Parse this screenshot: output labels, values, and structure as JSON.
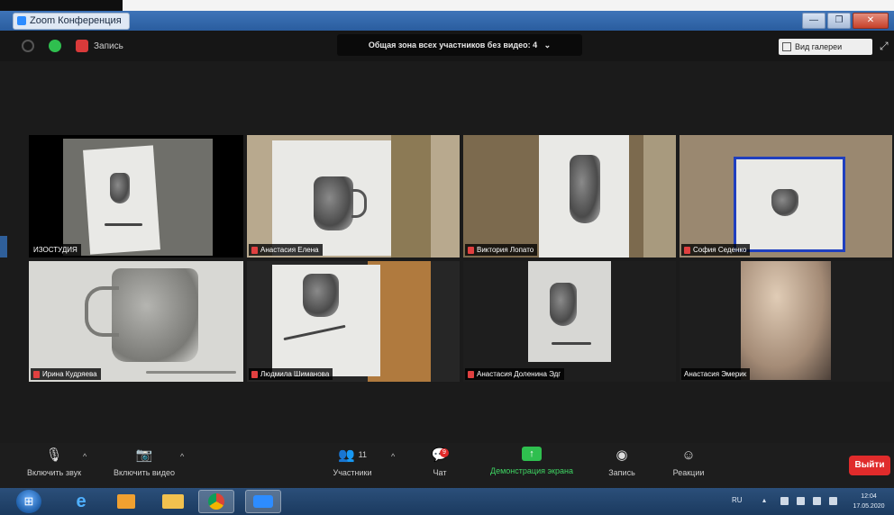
{
  "window": {
    "title": "Zoom Конференция",
    "buttons": [
      "—",
      "❐",
      "✕"
    ]
  },
  "top_bar": {
    "record_label": "Запись",
    "banner": "Общая зона всех участников без видео: 4",
    "view_button": "Вид галереи"
  },
  "gallery": [
    {
      "name": "ИЗОСТУДИЯ"
    },
    {
      "name": "Анастасия Елена"
    },
    {
      "name": "Виктория Лопато"
    },
    {
      "name": "София Седенко"
    },
    {
      "name": "Ирина Кудряева"
    },
    {
      "name": "Людмила Шиманова"
    },
    {
      "name": "Анастасия Доленина Эдг"
    },
    {
      "name": "Анастасия Эмерик"
    }
  ],
  "toolbar": {
    "mute": "Включить звук",
    "video": "Включить видео",
    "participants": "Участники",
    "participants_count": "11",
    "chat": "Чат",
    "chat_badge": "9",
    "share": "Демонстрация экрана",
    "record": "Запись",
    "reactions": "Реакции",
    "end": "Выйти"
  },
  "taskbar": {
    "lang": "RU",
    "time": "12:04",
    "date": "17.05.2020"
  }
}
